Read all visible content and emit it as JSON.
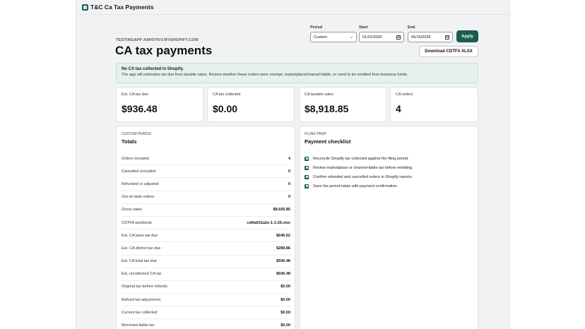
{
  "app": {
    "title": "T&C Ca Tax Payments"
  },
  "header": {
    "shop": "TESTINGAPP-A8HOTKV.MYSHOPIFY.COM",
    "title": "CA tax payments"
  },
  "filters": {
    "period": {
      "label": "Period",
      "value": "Custom"
    },
    "start": {
      "label": "Start",
      "value": "01/01/2026"
    },
    "end": {
      "label": "End",
      "value": "06/16/2026"
    },
    "apply_label": "Apply"
  },
  "download_label": "Download CDTFA XLSX",
  "banner": {
    "title": "No CA tax collected in Shopify.",
    "text": "The app still estimates tax due from taxable sales. Review whether these orders were exempt, marketplace/channel-liable, or need to be remitted from business funds."
  },
  "stats": [
    {
      "label": "Est. CA tax due",
      "value": "$936.48"
    },
    {
      "label": "CA tax collected",
      "value": "$0.00"
    },
    {
      "label": "CA taxable sales",
      "value": "$8,918.85"
    },
    {
      "label": "CA orders",
      "value": "4"
    }
  ],
  "totals": {
    "eyebrow": "CUSTOM PERIOD",
    "title": "Totals",
    "rows": [
      {
        "label": "Orders included",
        "value": "4"
      },
      {
        "label": "Cancelled excluded",
        "value": "0"
      },
      {
        "label": "Refunded or adjusted",
        "value": "0"
      },
      {
        "label": "Out-of-state orders",
        "value": "0"
      },
      {
        "label": "Gross sales",
        "value": "$8,926.85"
      },
      {
        "label": "CDTFA workbook",
        "value": "cdtfa531a2e-1-1-26.xlsx"
      },
      {
        "label": "Est. CA base tax due",
        "value": "$646.62"
      },
      {
        "label": "Est. CA district tax due",
        "value": "$289.86"
      },
      {
        "label": "Est. CA total tax due",
        "value": "$936.48"
      },
      {
        "label": "Est. uncollected CA tax",
        "value": "$936.48"
      },
      {
        "label": "Original tax before refunds",
        "value": "$0.00"
      },
      {
        "label": "Refund tax adjustment",
        "value": "$0.00"
      },
      {
        "label": "Current tax collected",
        "value": "$0.00"
      },
      {
        "label": "Merchant-liable tax",
        "value": "$0.00"
      }
    ]
  },
  "checklist": {
    "eyebrow": "FILING PREP",
    "title": "Payment checklist",
    "items": [
      "Reconcile Shopify tax collected against the filing period.",
      "Review marketplace or channel-liable tax before remitting.",
      "Confirm refunded and cancelled orders in Shopify reports.",
      "Save the period totals with payment confirmation."
    ]
  }
}
